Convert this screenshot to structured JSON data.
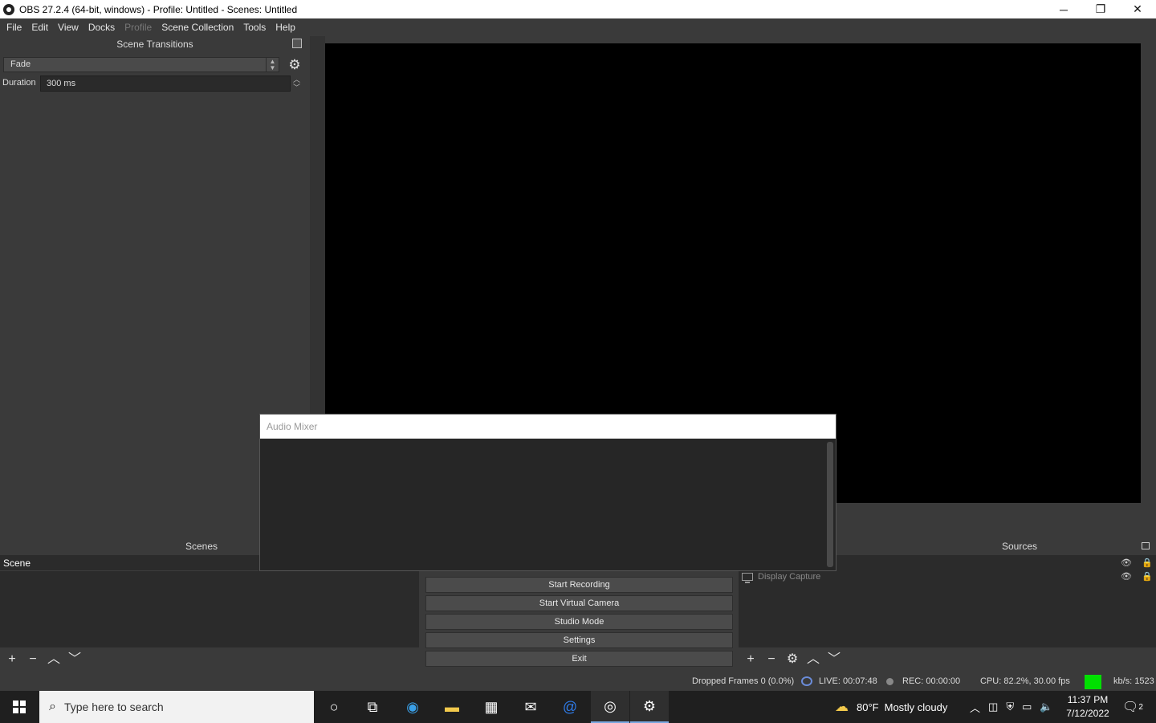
{
  "window": {
    "title": "OBS 27.2.4 (64-bit, windows) - Profile: Untitled - Scenes: Untitled",
    "minimize": "─",
    "maximize": "❐",
    "close": "✕"
  },
  "menu": [
    "File",
    "Edit",
    "View",
    "Docks",
    "Profile",
    "Scene Collection",
    "Tools",
    "Help"
  ],
  "transitions": {
    "title": "Scene Transitions",
    "selected": "Fade",
    "duration_label": "Duration",
    "duration_value": "300 ms"
  },
  "mixer": {
    "title": "Audio Mixer"
  },
  "scenes": {
    "title": "Scenes",
    "items": [
      "Scene"
    ]
  },
  "controls": {
    "buttons": [
      "Start Recording",
      "Start Virtual Camera",
      "Studio Mode",
      "Settings",
      "Exit"
    ]
  },
  "sources": {
    "title": "Sources",
    "items": [
      "Display Capture"
    ]
  },
  "status": {
    "dropped": "Dropped Frames 0 (0.0%)",
    "live": "LIVE: 00:07:48",
    "rec": "REC: 00:00:00",
    "cpu": "CPU: 82.2%, 30.00 fps",
    "kbs": "kb/s: 1523"
  },
  "taskbar": {
    "search_placeholder": "Type here to search",
    "weather_temp": "80°F",
    "weather_text": "Mostly cloudy",
    "time": "11:37 PM",
    "date": "7/12/2022",
    "notifications": "2"
  },
  "colors": {
    "accent_green": "#00e000",
    "panel": "#3a3a3a",
    "list_bg": "#2b2b2b"
  }
}
